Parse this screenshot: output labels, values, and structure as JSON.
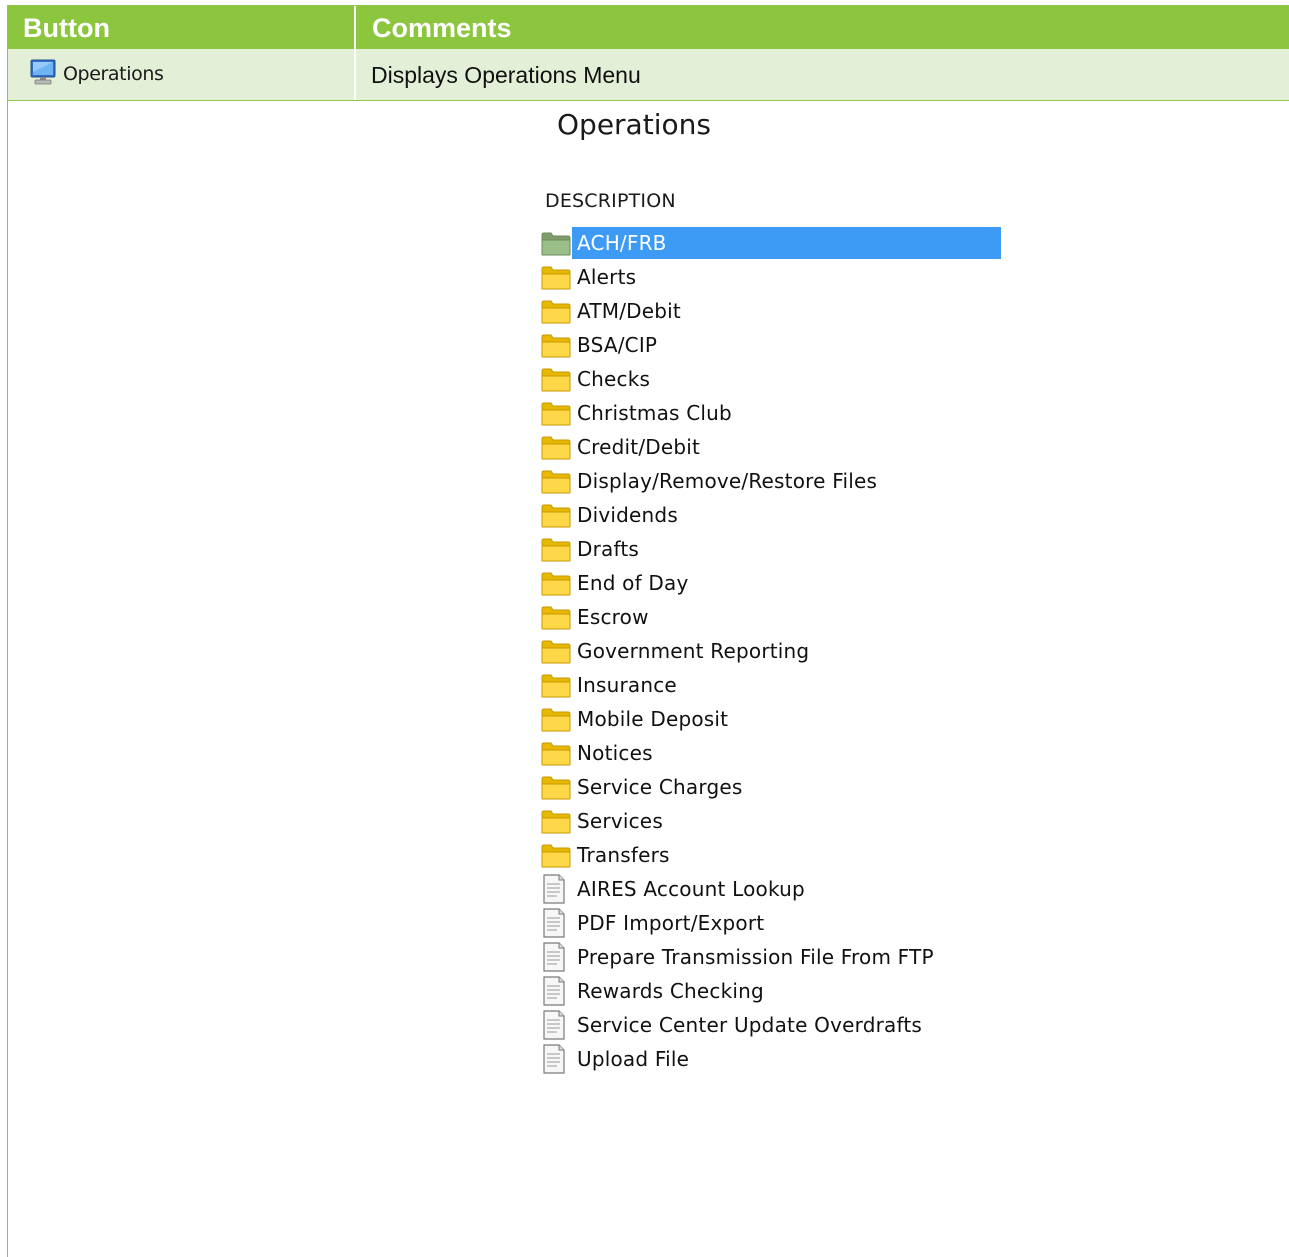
{
  "table": {
    "headers": {
      "button": "Button",
      "comments": "Comments"
    },
    "row": {
      "button_label": "Operations",
      "comment": "Displays Operations Menu"
    }
  },
  "screenshot": {
    "title": "Operations",
    "column_header": "DESCRIPTION",
    "items": [
      {
        "label": "ACH/FRB",
        "icon": "folder-icon",
        "selected": true
      },
      {
        "label": "Alerts",
        "icon": "folder-icon"
      },
      {
        "label": "ATM/Debit",
        "icon": "folder-icon"
      },
      {
        "label": "BSA/CIP",
        "icon": "folder-icon"
      },
      {
        "label": "Checks",
        "icon": "folder-icon"
      },
      {
        "label": "Christmas Club",
        "icon": "folder-icon"
      },
      {
        "label": "Credit/Debit",
        "icon": "folder-icon"
      },
      {
        "label": "Display/Remove/Restore Files",
        "icon": "folder-icon"
      },
      {
        "label": "Dividends",
        "icon": "folder-icon"
      },
      {
        "label": "Drafts",
        "icon": "folder-icon"
      },
      {
        "label": "End of Day",
        "icon": "folder-icon"
      },
      {
        "label": "Escrow",
        "icon": "folder-icon"
      },
      {
        "label": "Government Reporting",
        "icon": "folder-icon"
      },
      {
        "label": "Insurance",
        "icon": "folder-icon"
      },
      {
        "label": "Mobile Deposit",
        "icon": "folder-icon"
      },
      {
        "label": "Notices",
        "icon": "folder-icon"
      },
      {
        "label": "Service Charges",
        "icon": "folder-icon"
      },
      {
        "label": "Services",
        "icon": "folder-icon"
      },
      {
        "label": "Transfers",
        "icon": "folder-icon"
      },
      {
        "label": "AIRES Account Lookup",
        "icon": "document-icon"
      },
      {
        "label": "PDF Import/Export",
        "icon": "document-icon"
      },
      {
        "label": "Prepare Transmission File From FTP",
        "icon": "document-icon"
      },
      {
        "label": "Rewards Checking",
        "icon": "document-icon"
      },
      {
        "label": "Service Center Update Overdrafts",
        "icon": "document-icon"
      },
      {
        "label": "Upload File",
        "icon": "document-icon"
      }
    ]
  },
  "colors": {
    "header_green": "#8cc63f",
    "row_tint": "#e3efd6",
    "selection_blue": "#3d9bf5",
    "folder_yellow": "#ffd200",
    "folder_selected_green": "#8fae7b"
  }
}
